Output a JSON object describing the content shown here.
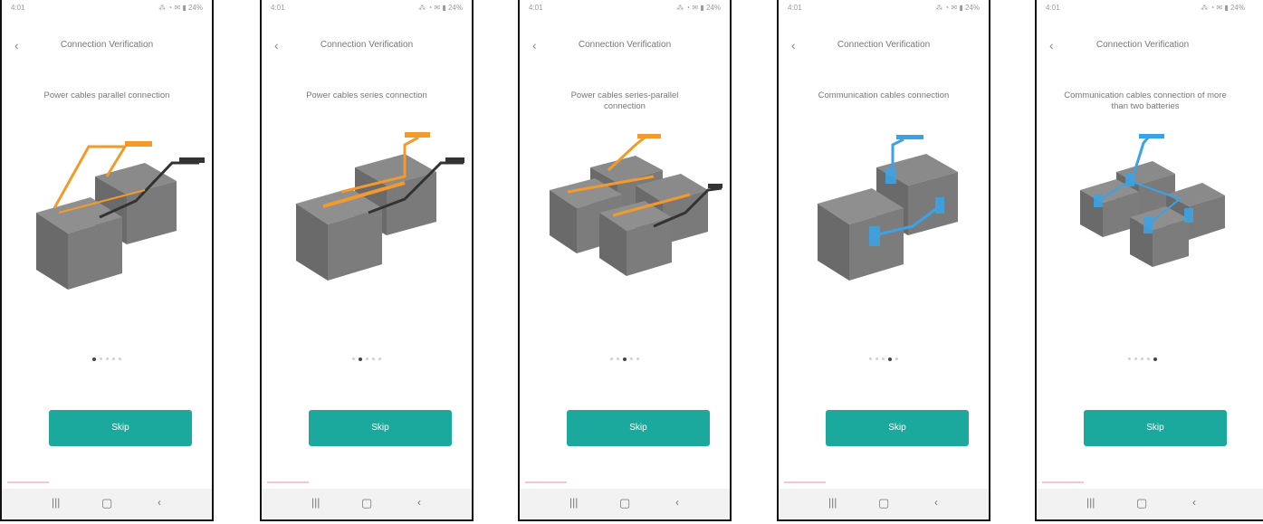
{
  "status_bar": {
    "time": "4:01",
    "icons": "⁂ ◔ ✉ ▮ 24%"
  },
  "nav_bar": {
    "recents": "|||",
    "home": "▢",
    "back": "‹"
  },
  "colors": {
    "accent": "#1aa99c",
    "orange_cable": "#f39a2b",
    "black_cable": "#333333",
    "blue_cable": "#3aa3e8",
    "battery": "#6e6e6e"
  },
  "screens": [
    {
      "back_icon": "‹",
      "title": "Connection Verification",
      "caption": "Power cables parallel connection",
      "active_dot": 0,
      "button_label": "Skip",
      "variant": "parallel"
    },
    {
      "back_icon": "‹",
      "title": "Connection Verification",
      "caption": "Power cables series connection",
      "active_dot": 1,
      "button_label": "Skip",
      "variant": "series"
    },
    {
      "back_icon": "‹",
      "title": "Connection Verification",
      "caption": "Power cables series-parallel connection",
      "active_dot": 2,
      "button_label": "Skip",
      "variant": "series-parallel"
    },
    {
      "back_icon": "‹",
      "title": "Connection Verification",
      "caption": "Communication cables connection",
      "active_dot": 3,
      "button_label": "Skip",
      "variant": "comm"
    },
    {
      "back_icon": "‹",
      "title": "Connection Verification",
      "caption": "Communication cables connection of more than two batteries",
      "active_dot": 4,
      "button_label": "Skip",
      "variant": "comm-multi"
    }
  ]
}
